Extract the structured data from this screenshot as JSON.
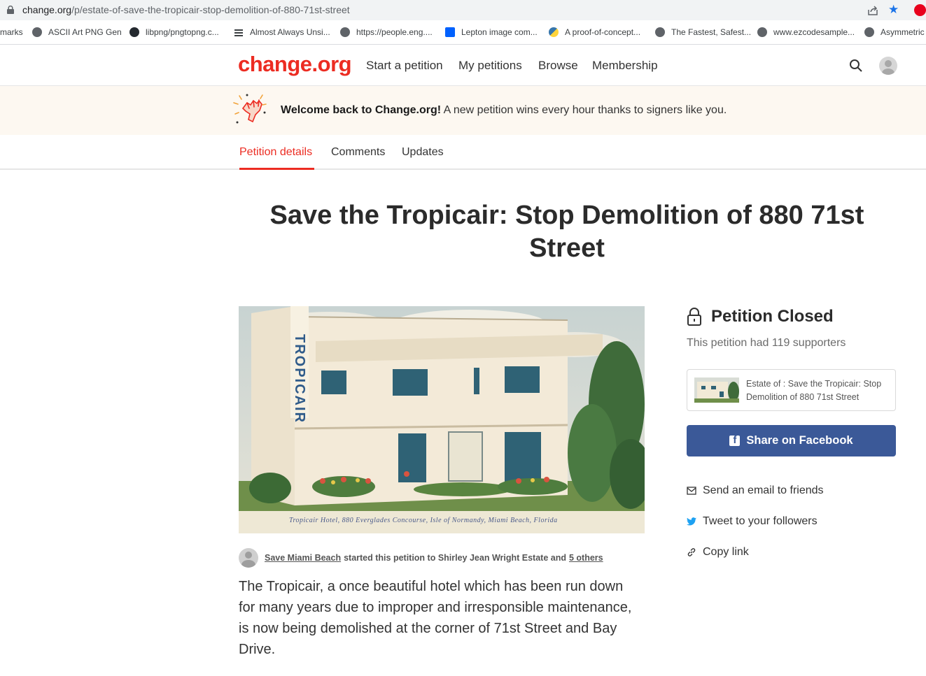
{
  "browser": {
    "url_host": "change.org",
    "url_path": "/p/estate-of-save-the-tropicair-stop-demolition-of-880-71st-street",
    "bookmarks": [
      {
        "label": "marks",
        "icon": "none"
      },
      {
        "label": "ASCII Art PNG Gen",
        "icon": "globe-icon"
      },
      {
        "label": "libpng/pngtopng.c...",
        "icon": "github-icon"
      },
      {
        "label": "Almost Always Unsi...",
        "icon": "list-icon"
      },
      {
        "label": "https://people.eng....",
        "icon": "globe-icon"
      },
      {
        "label": "Lepton image com...",
        "icon": "dropbox-icon"
      },
      {
        "label": "A proof-of-concept...",
        "icon": "python-icon"
      },
      {
        "label": "The Fastest, Safest...",
        "icon": "globe-icon"
      },
      {
        "label": "www.ezcodesample...",
        "icon": "globe-icon"
      },
      {
        "label": "Asymmetric",
        "icon": "globe-icon"
      }
    ]
  },
  "header": {
    "logo": "change.org",
    "nav": [
      "Start a petition",
      "My petitions",
      "Browse",
      "Membership"
    ]
  },
  "banner": {
    "bold": "Welcome back to Change.org!",
    "text": " A new petition wins every hour thanks to signers like you."
  },
  "tabs": [
    "Petition details",
    "Comments",
    "Updates"
  ],
  "petition": {
    "title": "Save the Tropicair: Stop Demolition of 880 71st Street",
    "image_caption": "Tropicair Hotel, 880 Everglades Concourse, Isle of Normandy, Miami Beach, Florida",
    "sign_text": "TROPICAIR",
    "starter_name": "Save Miami Beach",
    "starter_mid": "started this petition to Shirley Jean Wright Estate and",
    "starter_others": "5 others",
    "body": "The Tropicair, a once beautiful hotel which has been run down for many years due to improper and irresponsible maintenance, is now being demolished at the corner of 71st Street and Bay Drive."
  },
  "sidebar": {
    "status": "Petition Closed",
    "supporters": "This petition had 119 supporters",
    "card_text": "Estate of : Save the Tropicair: Stop Demolition of 880 71st Street",
    "facebook": "Share on Facebook",
    "email": "Send an email to friends",
    "tweet": "Tweet to your followers",
    "copy": "Copy link"
  },
  "colors": {
    "brand": "#ec2c22",
    "facebook": "#3b5998",
    "banner_bg": "#fdf8f1",
    "twitter": "#1da1f2"
  }
}
